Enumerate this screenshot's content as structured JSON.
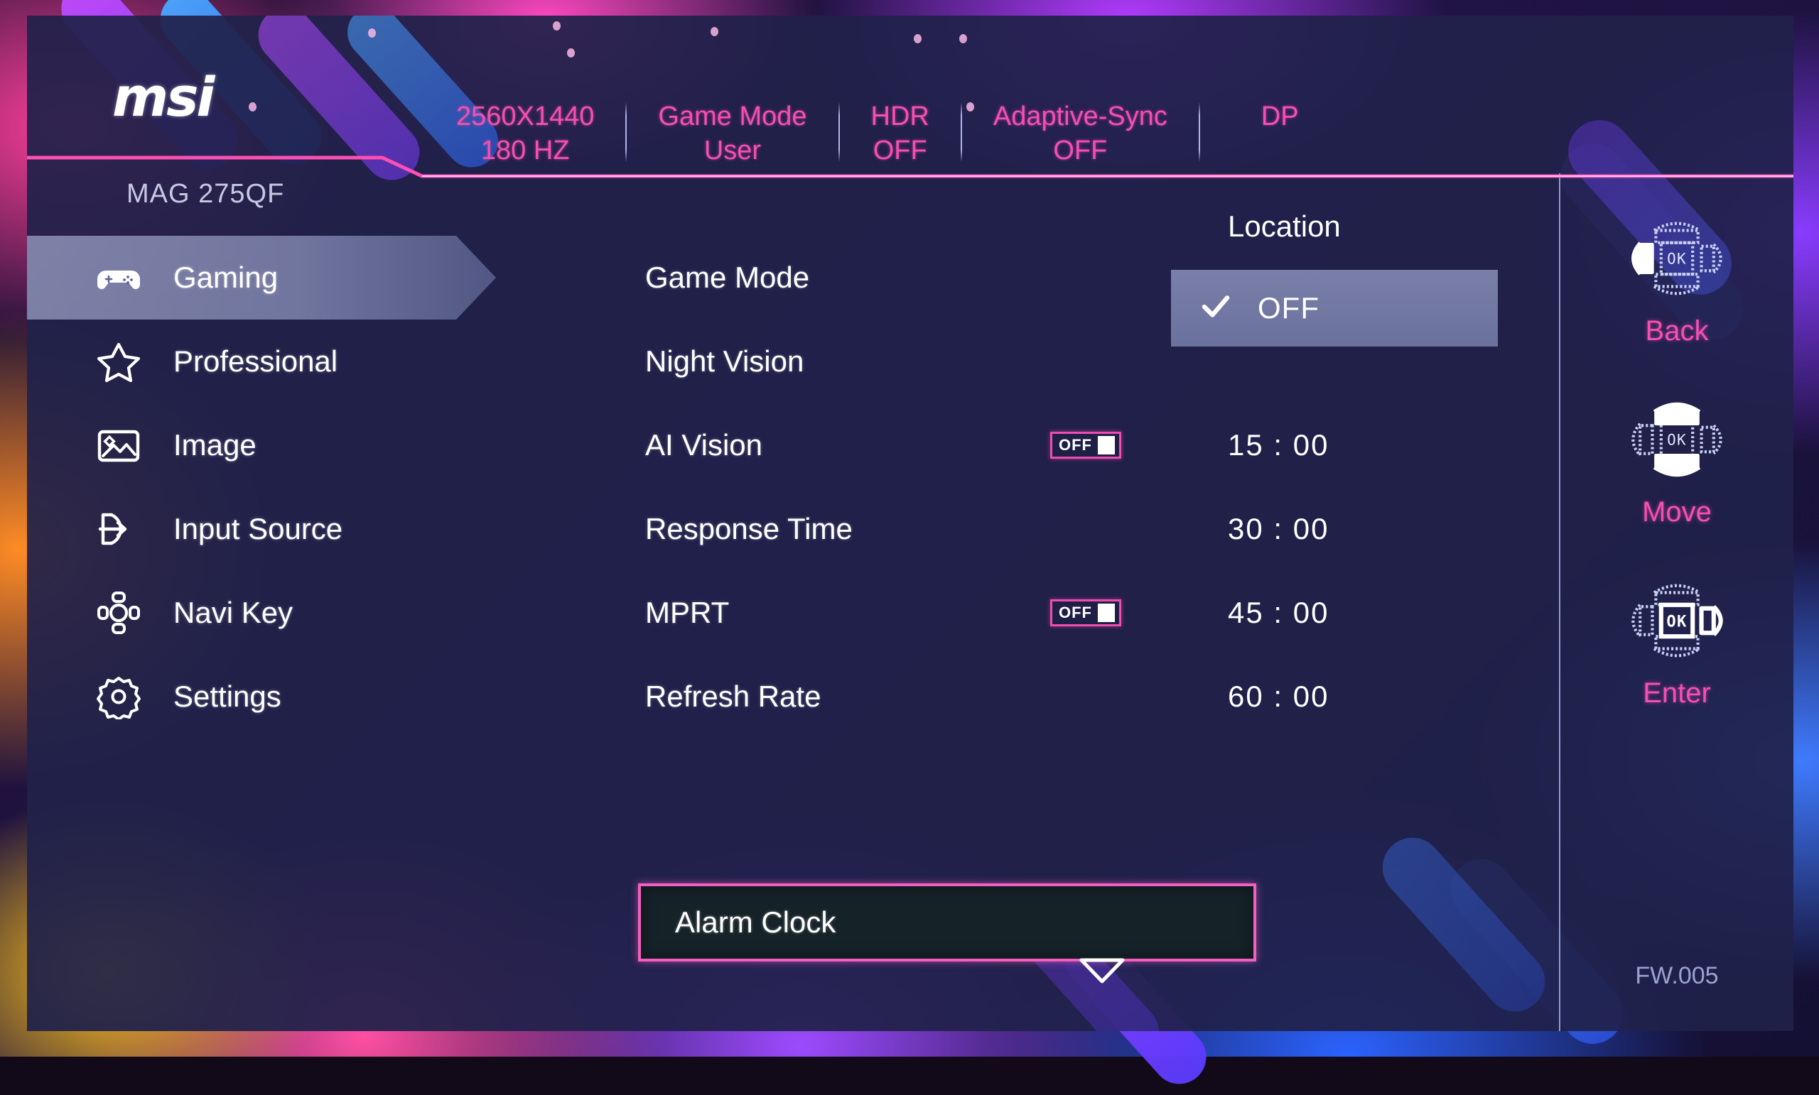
{
  "brand": {
    "logo_text": "msi"
  },
  "status_bar": {
    "items": [
      {
        "title": "2560X1440",
        "value": "180 HZ"
      },
      {
        "title": "Game Mode",
        "value": "User"
      },
      {
        "title": "HDR",
        "value": "OFF"
      },
      {
        "title": "Adaptive-Sync",
        "value": "OFF"
      },
      {
        "title": "DP",
        "value": ""
      }
    ]
  },
  "sidebar": {
    "model_name": "MAG 275QF",
    "items": [
      {
        "label": "Gaming",
        "icon": "gamepad-icon",
        "active": true
      },
      {
        "label": "Professional",
        "icon": "star-icon",
        "active": false
      },
      {
        "label": "Image",
        "icon": "picture-icon",
        "active": false
      },
      {
        "label": "Input Source",
        "icon": "input-arrow-icon",
        "active": false
      },
      {
        "label": "Navi Key",
        "icon": "dpad-icon",
        "active": false
      },
      {
        "label": "Settings",
        "icon": "gear-icon",
        "active": false
      }
    ]
  },
  "main": {
    "options": [
      {
        "label": "Game Mode",
        "toggle": null,
        "value": ""
      },
      {
        "label": "Night Vision",
        "toggle": null,
        "value": ""
      },
      {
        "label": "AI Vision",
        "toggle": "OFF",
        "value": "15 : 00"
      },
      {
        "label": "Response Time",
        "toggle": null,
        "value": "30 : 00"
      },
      {
        "label": "MPRT",
        "toggle": "OFF",
        "value": "45 : 00"
      },
      {
        "label": "Refresh Rate",
        "toggle": null,
        "value": "60 : 00"
      }
    ],
    "value_column_header": "Location",
    "selected_value": {
      "label": "OFF",
      "checked": true
    },
    "focused_row": {
      "label": "Alarm Clock"
    },
    "scroll_indicator": "chevron-down-icon"
  },
  "nav_keys": {
    "items": [
      {
        "label": "Back",
        "highlight": "left",
        "center_text": "OK"
      },
      {
        "label": "Move",
        "highlight": "updown",
        "center_text": "OK"
      },
      {
        "label": "Enter",
        "highlight": "enter",
        "center_text": "OK"
      }
    ],
    "firmware": "FW.005"
  },
  "colors": {
    "accent_pink": "#f54fb0",
    "panel_bg": "#20214a",
    "highlight_row": "#b0bae2",
    "focus_border": "#f35fc0",
    "focus_fill": "#152228",
    "text_white": "#ffffff",
    "muted": "#9aa2cf"
  }
}
